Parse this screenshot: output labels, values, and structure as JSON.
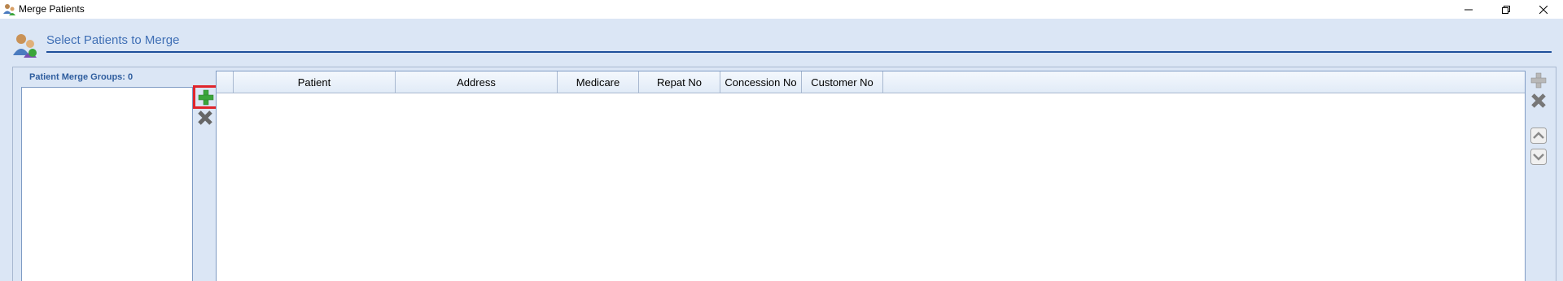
{
  "window": {
    "title": "Merge Patients"
  },
  "header": {
    "title": "Select Patients to Merge"
  },
  "groups": {
    "label": "Patient Merge Groups: 0"
  },
  "table": {
    "columns": [
      {
        "label": "",
        "key": "select"
      },
      {
        "label": "Patient",
        "key": "patient"
      },
      {
        "label": "Address",
        "key": "address"
      },
      {
        "label": "Medicare",
        "key": "medicare"
      },
      {
        "label": "Repat No",
        "key": "repat_no"
      },
      {
        "label": "Concession No",
        "key": "concession_no"
      },
      {
        "label": "Customer No",
        "key": "customer_no"
      }
    ],
    "rows": []
  },
  "colors": {
    "accent": "#1e4f9a",
    "title_text": "#3f6fb5",
    "highlight": "#e0252c",
    "add_green": "#3aa53a"
  }
}
